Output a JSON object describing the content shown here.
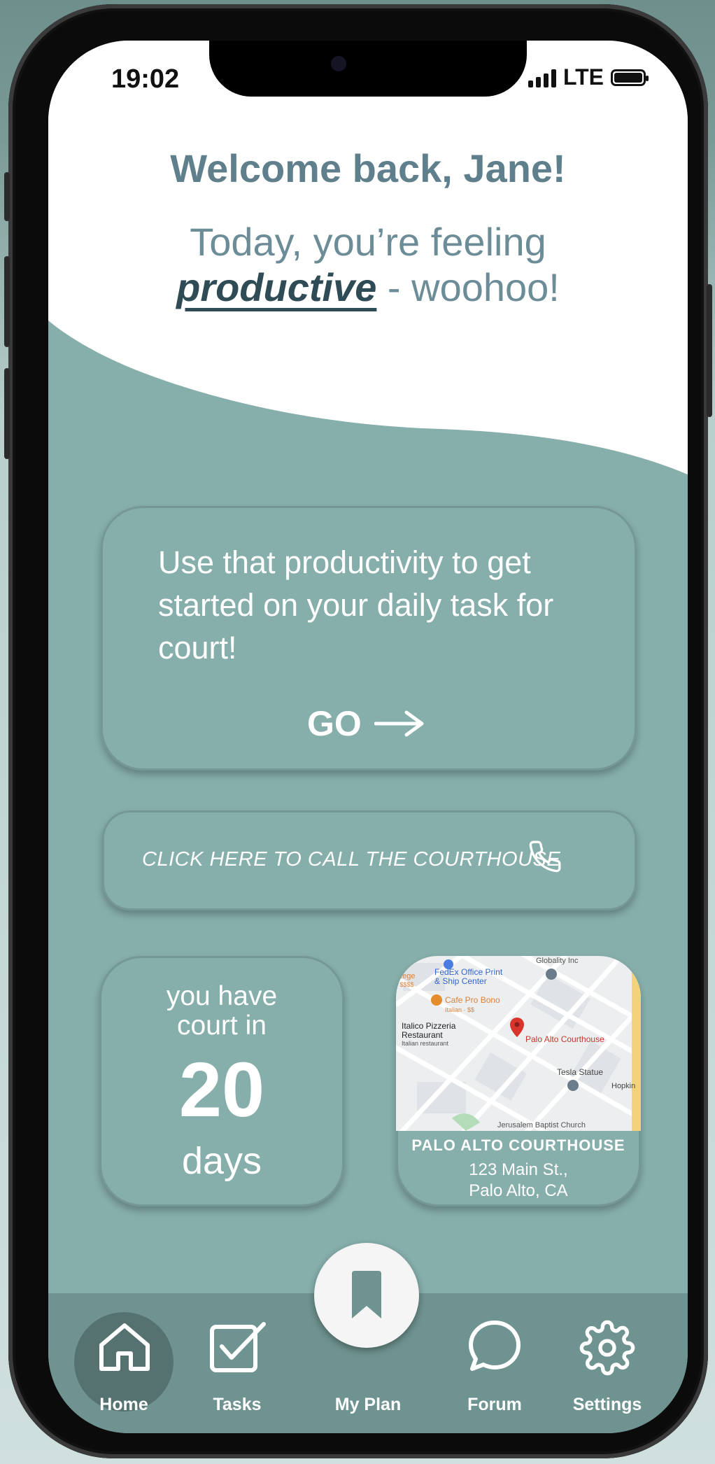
{
  "status_bar": {
    "time": "19:02",
    "network": "LTE"
  },
  "header": {
    "welcome": "Welcome back, Jane!",
    "mood_prefix": "Today, you’re feeling",
    "mood_word": "productive",
    "mood_suffix": " - woohoo!"
  },
  "task_card": {
    "text": "Use that productivity to get started on your daily task for court!",
    "go_label": "GO"
  },
  "call_card": {
    "label": "CLICK HERE TO CALL THE COURTHOUSE"
  },
  "countdown": {
    "line1": "you have",
    "line2": "court in",
    "days": "20",
    "unit": "days"
  },
  "courthouse": {
    "name": "PALO ALTO COURTHOUSE",
    "address_line1": "123 Main St.,",
    "address_line2": "Palo Alto, CA",
    "map_labels": {
      "fedex": "FedEx Office Print",
      "fedex2": "& Ship Center",
      "globality": "Globality Inc",
      "cafe": "Cafe Pro Bono",
      "cafe_sub": "Italian · $$",
      "italico": "Italico Pizzeria",
      "italico2": "Restaurant",
      "italico_sub": "Italian restaurant",
      "pin": "Palo Alto Courthouse",
      "tesla": "Tesla Statue",
      "hopkins": "Hopkin",
      "church": "Jerusalem Baptist Church",
      "otege": "otege",
      "otege_sub": "· $$$$"
    }
  },
  "nav": {
    "home": "Home",
    "tasks": "Tasks",
    "my_plan": "My Plan",
    "forum": "Forum",
    "settings": "Settings"
  },
  "colors": {
    "teal": "#86aeab",
    "navbar": "#6f9390",
    "heading": "#5f7f8d",
    "white": "#ffffff"
  }
}
